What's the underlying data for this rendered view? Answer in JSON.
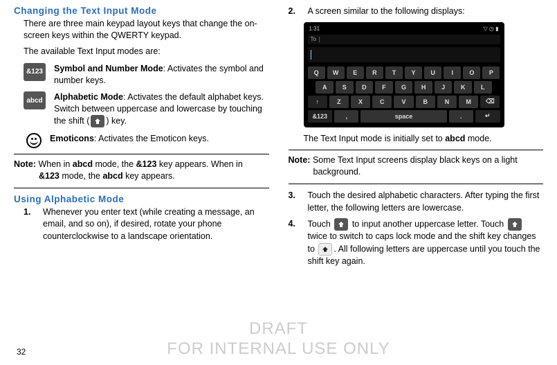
{
  "left": {
    "heading1": "Changing the Text Input Mode",
    "p1": "There are three main keypad layout keys that change the on-screen keys within the QWERTY keypad.",
    "p2": "The available Text Input modes are:",
    "modes": {
      "sym": {
        "chip": "&123",
        "label": "Symbol and Number Mode",
        "desc": ": Activates the symbol and number keys."
      },
      "abc": {
        "chip": "abcd",
        "label": "Alphabetic Mode",
        "desc_a": ": Activates the default alphabet keys. Switch between uppercase and lowercase by touching the shift (",
        "desc_b": ") key."
      },
      "emo": {
        "label": "Emoticons",
        "desc": ": Activates the Emoticon keys."
      }
    },
    "note": {
      "label": "Note:",
      "text": "When in abcd mode, the &123 key appears. When in &123 mode, the abcd key appears."
    },
    "note_html": "When in <b>abcd</b> mode, the <b>&123</b> key appears. When in <b>&123</b> mode, the <b>abcd</b> key appears.",
    "heading2": "Using Alphabetic Mode",
    "step1": {
      "num": "1.",
      "text": "Whenever you enter text (while creating a message, an email, and so on), if desired, rotate your phone counterclockwise to a landscape orientation."
    }
  },
  "right": {
    "step2": {
      "num": "2.",
      "text": "A screen similar to the following displays:"
    },
    "topbar_time": "1:31",
    "to_label": "To",
    "kb": {
      "r1": [
        "Q",
        "W",
        "E",
        "R",
        "T",
        "Y",
        "U",
        "I",
        "O",
        "P"
      ],
      "r2": [
        "A",
        "S",
        "D",
        "F",
        "G",
        "H",
        "J",
        "K",
        "L"
      ],
      "r3": [
        "↑",
        "Z",
        "X",
        "C",
        "V",
        "B",
        "N",
        "M",
        "⌫"
      ],
      "r4": [
        "&123",
        ",",
        "space",
        ".",
        "↵"
      ]
    },
    "caption_a": "The Text Input mode is initially set to ",
    "caption_b": "abcd",
    "caption_c": " mode.",
    "note": {
      "label": "Note:",
      "text": "Some Text Input screens display black keys on a light background."
    },
    "step3": {
      "num": "3.",
      "text": "Touch the desired alphabetic characters. After typing the first letter, the following letters are lowercase."
    },
    "step4": {
      "num": "4.",
      "a": "Touch ",
      "b": " to input another uppercase letter. Touch ",
      "c": " twice to switch to caps lock mode and the shift key changes to ",
      "d": ". All following letters are uppercase until you touch the shift key again."
    }
  },
  "watermark": {
    "l1": "DRAFT",
    "l2": "FOR INTERNAL USE ONLY"
  },
  "pagenum": "32"
}
